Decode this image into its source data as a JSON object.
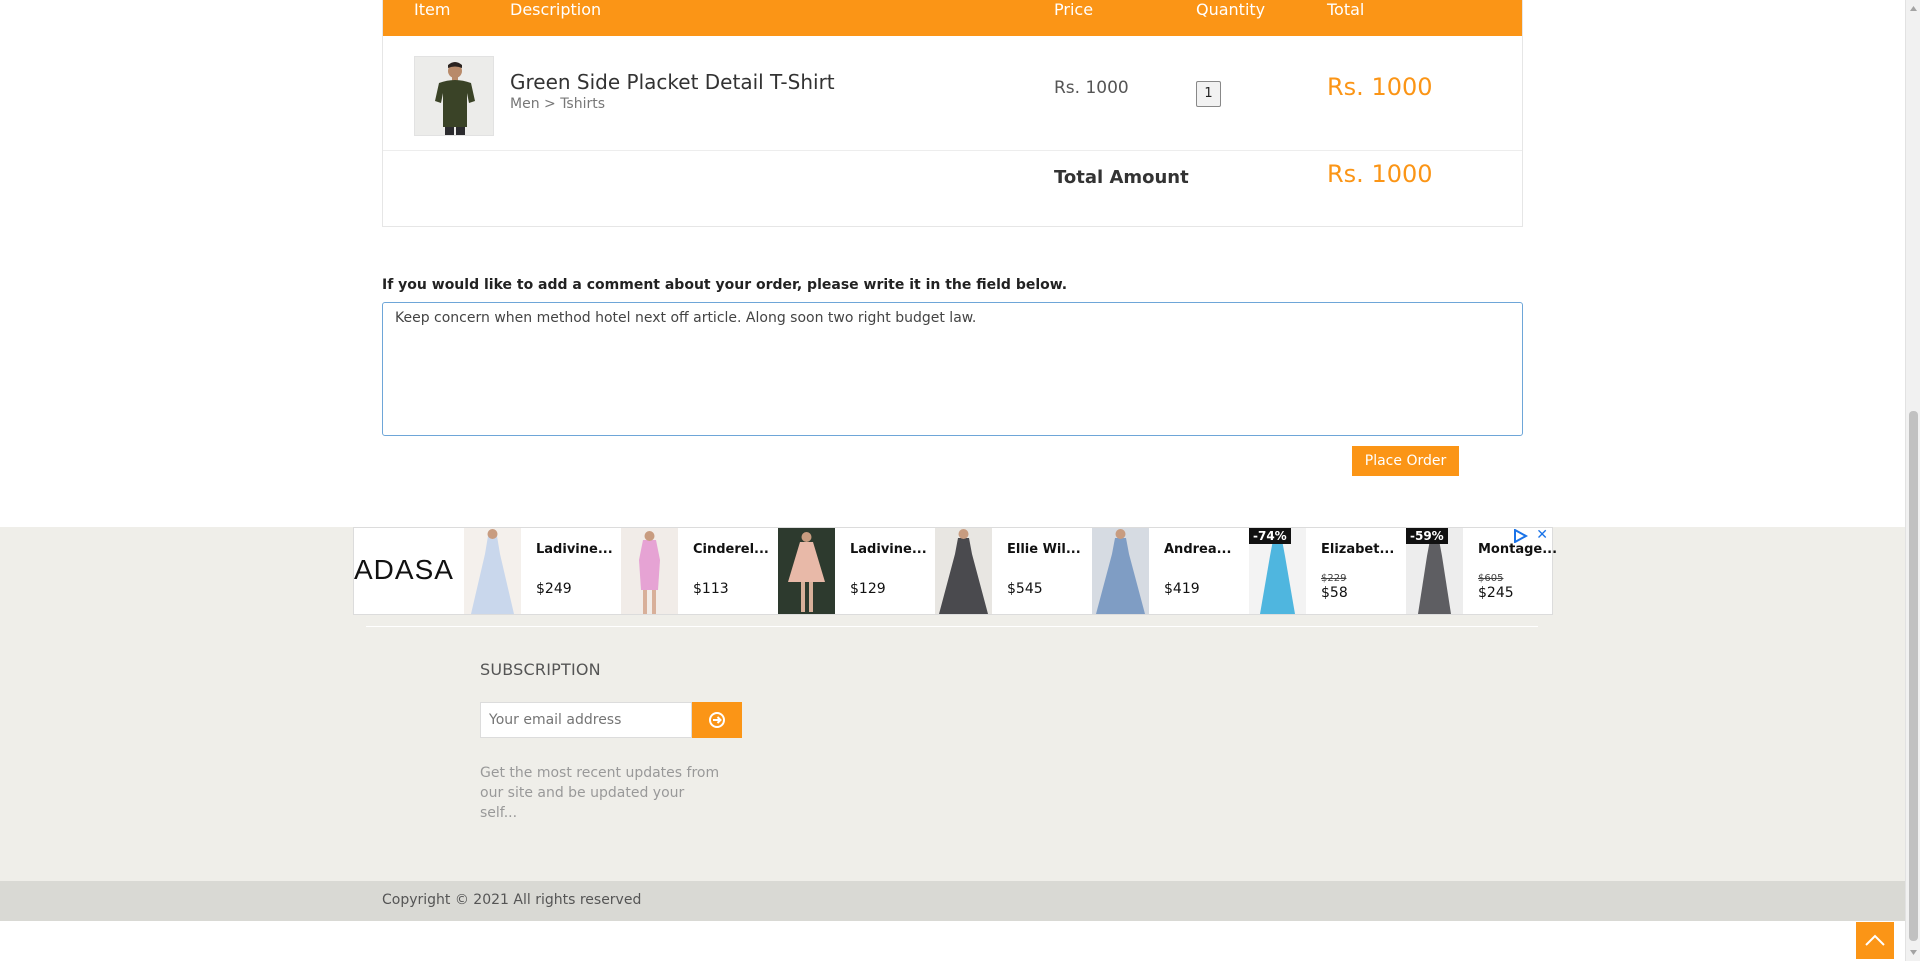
{
  "cart": {
    "columns": {
      "item": "Item",
      "description": "Description",
      "price": "Price",
      "quantity": "Quantity",
      "total": "Total"
    },
    "product": {
      "name": "Green Side Placket Detail T-Shirt",
      "category": "Men > Tshirts",
      "price": "Rs. 1000",
      "quantity": "1",
      "total": "Rs. 1000",
      "image_icon": "tshirt-model-photo"
    },
    "total_label": "Total Amount",
    "total_value": "Rs. 1000"
  },
  "comment": {
    "label": "If you would like to add a comment about your order, please write it in the field below.",
    "value": "Keep concern when method hotel next off article. Along soon two right budget law."
  },
  "place_order_label": "Place Order",
  "ad": {
    "brand": "ADASA",
    "items": [
      {
        "name": "Ladivine...",
        "price": "$249",
        "color": "#c9d7ec"
      },
      {
        "name": "Cinderel...",
        "price": "$113",
        "color": "#e6a3d4"
      },
      {
        "name": "Ladivine...",
        "price": "$129",
        "color": "#e8b9a8"
      },
      {
        "name": "Ellie Wil...",
        "price": "$545",
        "color": "#4a4a4e"
      },
      {
        "name": "Andrea...",
        "price": "$419",
        "color": "#7f9dc4"
      },
      {
        "name": "Elizabet...",
        "old_price": "$229",
        "price": "$58",
        "badge": "-74%",
        "color": "#4fb6df"
      },
      {
        "name": "Montage...",
        "old_price": "$605",
        "price": "$245",
        "badge": "-59%",
        "color": "#5e5e62"
      }
    ]
  },
  "subscription": {
    "title": "SUBSCRIPTION",
    "placeholder": "Your email address",
    "description": "Get the most recent updates from our site and be updated your self..."
  },
  "copyright": "Copyright © 2021 All rights reserved",
  "colors": {
    "accent": "#fb9516",
    "footer": "#efeee9",
    "copyright_bar": "#d9d9d4"
  }
}
